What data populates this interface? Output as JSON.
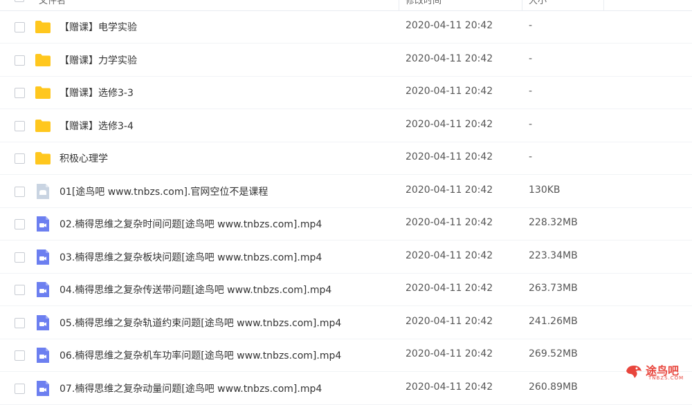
{
  "header": {
    "col_name": "文件名",
    "col_modified": "修改时间",
    "col_size": "大小"
  },
  "files": [
    {
      "name": "【赠课】电学实验",
      "modified": "2020-04-11 20:42",
      "size": "-",
      "type": "folder"
    },
    {
      "name": "【赠课】力学实验",
      "modified": "2020-04-11 20:42",
      "size": "-",
      "type": "folder"
    },
    {
      "name": "【赠课】选修3-3",
      "modified": "2020-04-11 20:42",
      "size": "-",
      "type": "folder"
    },
    {
      "name": "【赠课】选修3-4",
      "modified": "2020-04-11 20:42",
      "size": "-",
      "type": "folder"
    },
    {
      "name": "积极心理学",
      "modified": "2020-04-11 20:42",
      "size": "-",
      "type": "folder"
    },
    {
      "name": "01[途鸟吧 www.tnbzs.com].官网空位不是课程",
      "modified": "2020-04-11 20:42",
      "size": "130KB",
      "type": "image"
    },
    {
      "name": "02.楠得思维之复杂时间问题[途鸟吧 www.tnbzs.com].mp4",
      "modified": "2020-04-11 20:42",
      "size": "228.32MB",
      "type": "video"
    },
    {
      "name": "03.楠得思维之复杂板块问题[途鸟吧 www.tnbzs.com].mp4",
      "modified": "2020-04-11 20:42",
      "size": "223.34MB",
      "type": "video"
    },
    {
      "name": "04.楠得思维之复杂传送带问题[途鸟吧 www.tnbzs.com].mp4",
      "modified": "2020-04-11 20:42",
      "size": "263.73MB",
      "type": "video"
    },
    {
      "name": "05.楠得思维之复杂轨道约束问题[途鸟吧 www.tnbzs.com].mp4",
      "modified": "2020-04-11 20:42",
      "size": "241.26MB",
      "type": "video"
    },
    {
      "name": "06.楠得思维之复杂机车功率问题[途鸟吧 www.tnbzs.com].mp4",
      "modified": "2020-04-11 20:42",
      "size": "269.52MB",
      "type": "video"
    },
    {
      "name": "07.楠得思维之复杂动量问题[途鸟吧 www.tnbzs.com].mp4",
      "modified": "2020-04-11 20:42",
      "size": "260.89MB",
      "type": "video"
    }
  ],
  "watermark": {
    "text": "途鸟吧",
    "sub": "TNBZS.COM"
  },
  "colors": {
    "folder": "#ffc71e",
    "video": "#6c7ff0",
    "image": "#c9d4e2",
    "accent": "#2b7bf6"
  }
}
